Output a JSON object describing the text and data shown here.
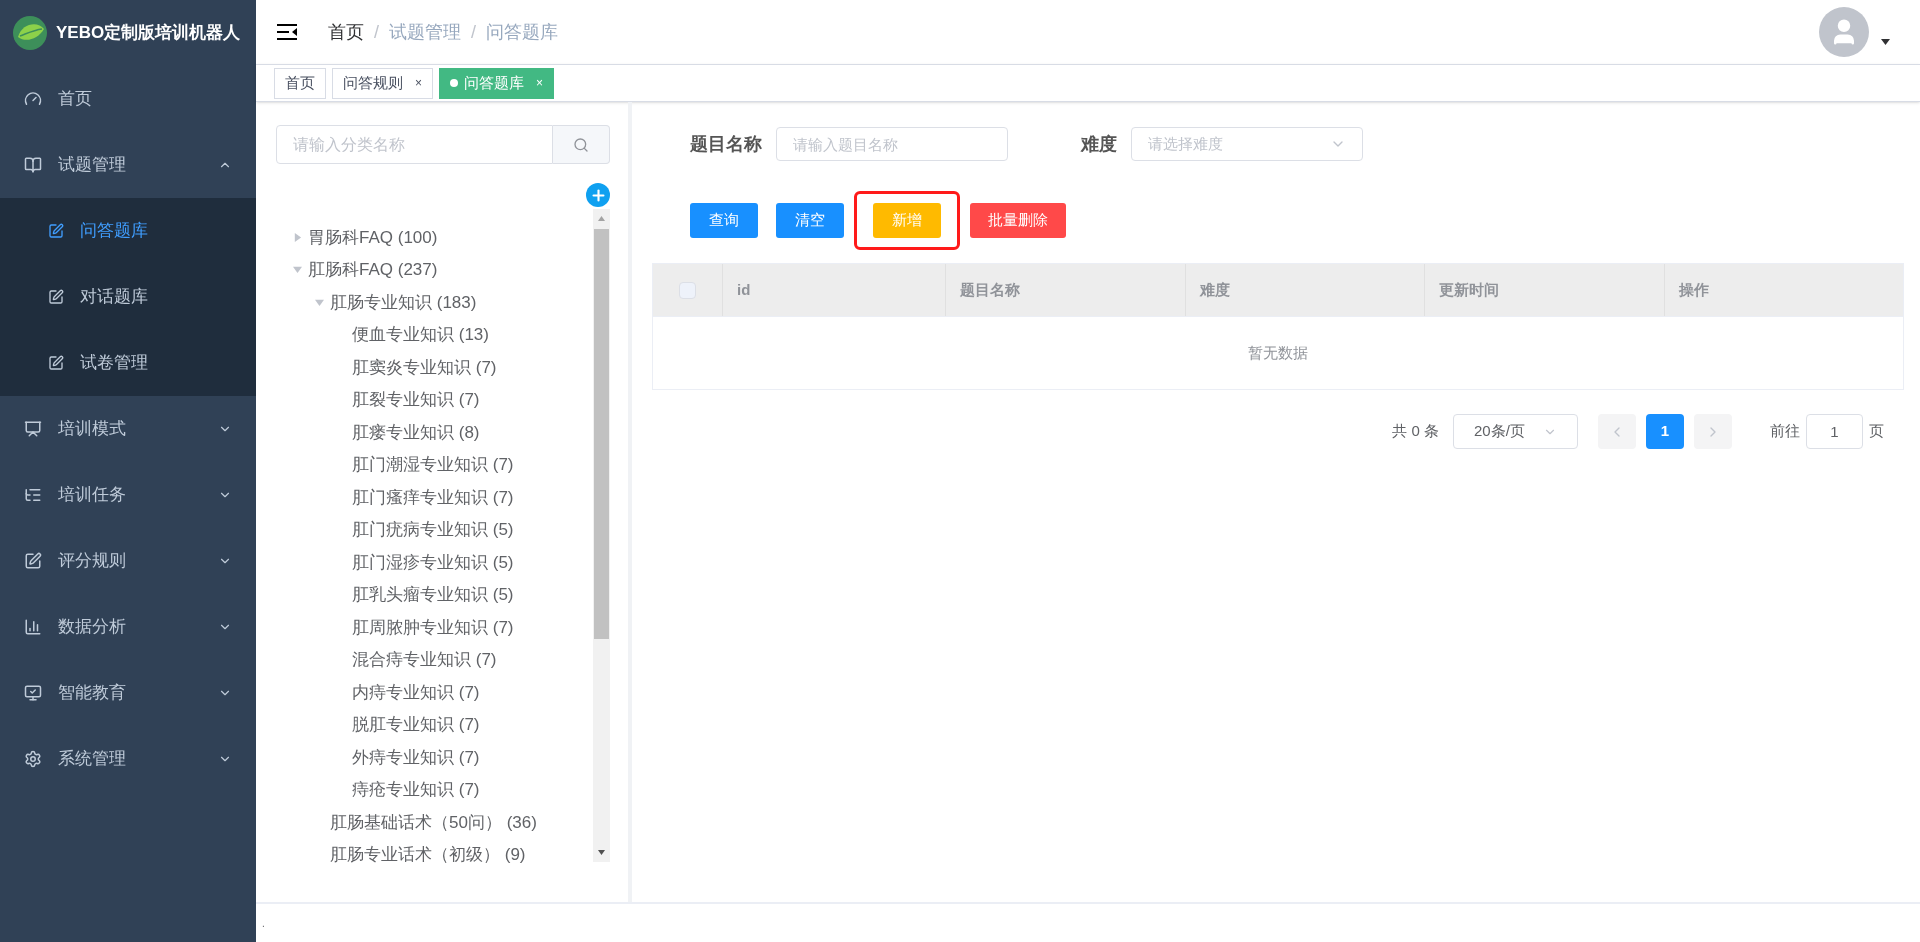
{
  "app": {
    "title": "YEBO定制版培训机器人"
  },
  "sidebar": {
    "items": [
      {
        "label": "首页",
        "kind": "link",
        "selected": false
      },
      {
        "label": "试题管理",
        "kind": "group",
        "expanded": true,
        "children": [
          {
            "label": "问答题库",
            "selected": true
          },
          {
            "label": "对话题库",
            "selected": false
          },
          {
            "label": "试卷管理",
            "selected": false
          }
        ]
      },
      {
        "label": "培训模式",
        "kind": "group",
        "expanded": false
      },
      {
        "label": "培训任务",
        "kind": "group",
        "expanded": false
      },
      {
        "label": "评分规则",
        "kind": "group",
        "expanded": false
      },
      {
        "label": "数据分析",
        "kind": "group",
        "expanded": false
      },
      {
        "label": "智能教育",
        "kind": "group",
        "expanded": false
      },
      {
        "label": "系统管理",
        "kind": "group",
        "expanded": false
      }
    ]
  },
  "breadcrumb": {
    "separator": "/",
    "items": [
      "首页",
      "试题管理",
      "问答题库"
    ]
  },
  "tabs": [
    {
      "label": "首页",
      "selected": false
    },
    {
      "label": "问答规则",
      "selected": false,
      "close": "×"
    },
    {
      "label": "问答题库",
      "selected": true,
      "close": "×"
    }
  ],
  "tree": {
    "search": {
      "placeholder": "请输入分类名称"
    },
    "nodes": [
      {
        "label": "胃肠科FAQ (100)",
        "expanded": false
      },
      {
        "label": "肛肠科FAQ (237)",
        "expanded": true,
        "children": [
          {
            "label": "肛肠专业知识 (183)",
            "expanded": true,
            "children": [
              {
                "label": "便血专业知识 (13)"
              },
              {
                "label": "肛窦炎专业知识 (7)"
              },
              {
                "label": "肛裂专业知识 (7)"
              },
              {
                "label": "肛瘘专业知识 (8)"
              },
              {
                "label": "肛门潮湿专业知识 (7)"
              },
              {
                "label": "肛门瘙痒专业知识 (7)"
              },
              {
                "label": "肛门疣病专业知识 (5)"
              },
              {
                "label": "肛门湿疹专业知识 (5)"
              },
              {
                "label": "肛乳头瘤专业知识 (5)"
              },
              {
                "label": "肛周脓肿专业知识 (7)"
              },
              {
                "label": "混合痔专业知识 (7)"
              },
              {
                "label": "内痔专业知识 (7)"
              },
              {
                "label": "脱肛专业知识 (7)"
              },
              {
                "label": "外痔专业知识 (7)"
              },
              {
                "label": "痔疮专业知识 (7)"
              }
            ]
          },
          {
            "label": "肛肠基础话术（50问） (36)"
          },
          {
            "label": "肛肠专业话术（初级） (9)"
          }
        ]
      }
    ]
  },
  "filters": [
    {
      "label": "题目名称",
      "kind": "input",
      "placeholder": "请输入题目名称"
    },
    {
      "label": "难度",
      "kind": "select",
      "placeholder": "请选择难度"
    }
  ],
  "buttons": [
    {
      "label": "查询",
      "kind": "primary",
      "highlighted": false
    },
    {
      "label": "清空",
      "kind": "primary",
      "highlighted": false
    },
    {
      "label": "新增",
      "kind": "warning",
      "highlighted": true
    },
    {
      "label": "批量删除",
      "kind": "danger",
      "highlighted": false
    }
  ],
  "table": {
    "select_all_checked": false,
    "columns": [
      "id",
      "题目名称",
      "难度",
      "更新时间",
      "操作"
    ],
    "empty_text": "暂无数据"
  },
  "pagination": {
    "total": "共 0 条",
    "page_size": "20条/页",
    "pages": [
      {
        "label": "1",
        "selected": true
      }
    ],
    "goto_label": "前往",
    "goto_value": "1",
    "goto_suffix": "页"
  },
  "footer": {
    "text": "."
  }
}
